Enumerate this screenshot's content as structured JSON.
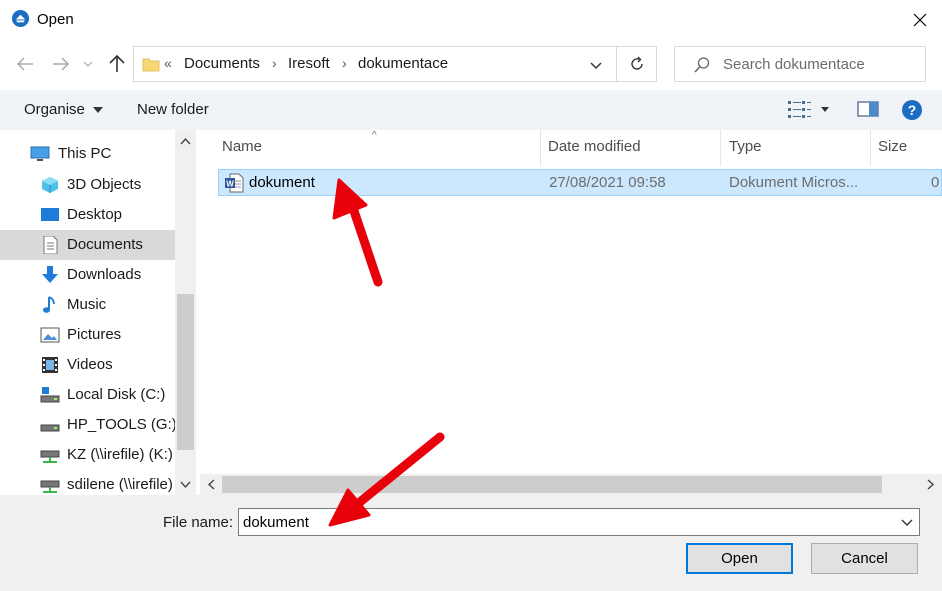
{
  "window": {
    "title": "Open",
    "title_icon": "chrome-icon",
    "close_icon": "close-icon"
  },
  "address": {
    "overflow": "«",
    "breadcrumbs": [
      "Documents",
      "Iresoft",
      "dokumentace"
    ],
    "search_placeholder": "Search dokumentace"
  },
  "toolbar": {
    "organise": "Organise",
    "new_folder": "New folder"
  },
  "sidebar": {
    "items": [
      {
        "label": "This PC",
        "icon": "this-pc-icon"
      },
      {
        "label": "3D Objects",
        "icon": "3d-objects-icon"
      },
      {
        "label": "Desktop",
        "icon": "desktop-icon"
      },
      {
        "label": "Documents",
        "icon": "documents-icon"
      },
      {
        "label": "Downloads",
        "icon": "downloads-icon"
      },
      {
        "label": "Music",
        "icon": "music-icon"
      },
      {
        "label": "Pictures",
        "icon": "pictures-icon"
      },
      {
        "label": "Videos",
        "icon": "videos-icon"
      },
      {
        "label": "Local Disk (C:)",
        "icon": "local-disk-icon"
      },
      {
        "label": "HP_TOOLS (G:)",
        "icon": "drive-icon"
      },
      {
        "label": "KZ (\\\\irefile) (K:)",
        "icon": "network-drive-icon"
      },
      {
        "label": "sdilene (\\\\irefile)",
        "icon": "network-drive-icon"
      }
    ],
    "selected": "Documents"
  },
  "columns": {
    "name": "Name",
    "date": "Date modified",
    "type": "Type",
    "size": "Size"
  },
  "files": [
    {
      "name": "dokument",
      "date": "27/08/2021 09:58",
      "type": "Dokument Micros...",
      "size": "0",
      "icon": "word-document-icon"
    }
  ],
  "filename": {
    "label": "File name:",
    "value": "dokument"
  },
  "buttons": {
    "open": "Open",
    "cancel": "Cancel"
  },
  "colors": {
    "accent": "#0078d7",
    "selection": "#cce8ff",
    "annotation_arrow": "#e8000b"
  }
}
